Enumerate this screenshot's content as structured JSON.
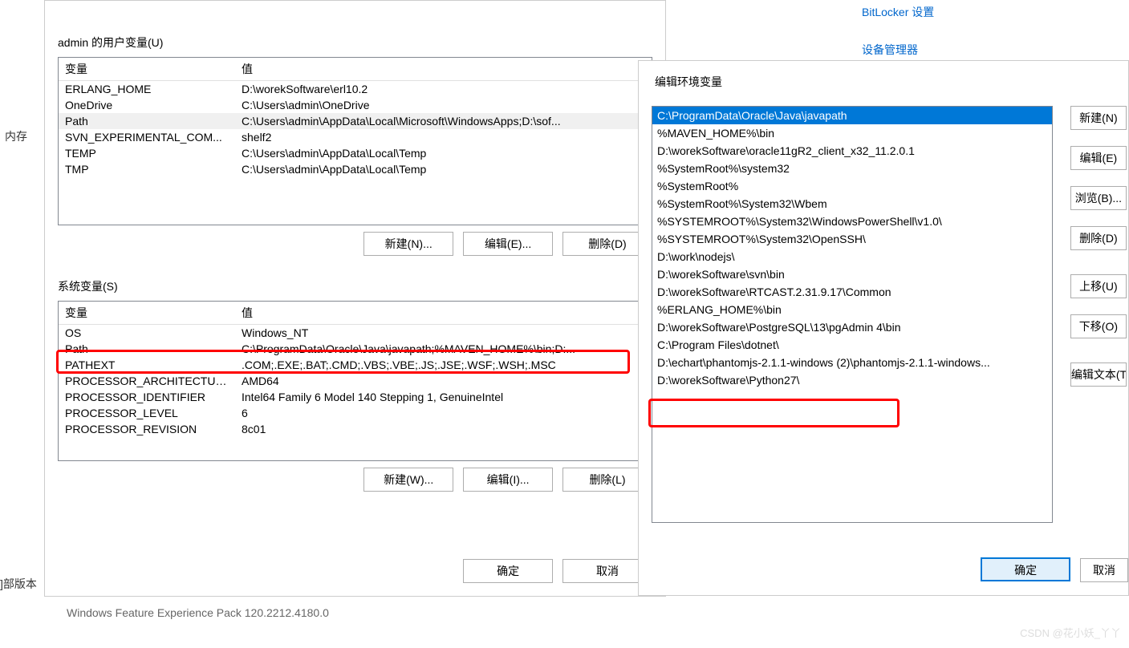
{
  "bg": {
    "link1": "BitLocker 设置",
    "link2": "设备管理器",
    "mem": "内存",
    "ver": "]部版本",
    "pack": "Windows Feature Experience Pack 120.2212.4180.0",
    "watermark": "CSDN @花小妖_丫丫"
  },
  "envvars": {
    "user_label": "admin 的用户变量(U)",
    "sys_label": "系统变量(S)",
    "col_var": "变量",
    "col_val": "值",
    "user_rows": [
      {
        "k": "ERLANG_HOME",
        "v": "D:\\worekSoftware\\erl10.2"
      },
      {
        "k": "OneDrive",
        "v": "C:\\Users\\admin\\OneDrive"
      },
      {
        "k": "Path",
        "v": "C:\\Users\\admin\\AppData\\Local\\Microsoft\\WindowsApps;D:\\sof...",
        "sel": true
      },
      {
        "k": "SVN_EXPERIMENTAL_COM...",
        "v": "shelf2"
      },
      {
        "k": "TEMP",
        "v": "C:\\Users\\admin\\AppData\\Local\\Temp"
      },
      {
        "k": "TMP",
        "v": "C:\\Users\\admin\\AppData\\Local\\Temp"
      }
    ],
    "sys_rows": [
      {
        "k": "OS",
        "v": "Windows_NT"
      },
      {
        "k": "Path",
        "v": "C:\\ProgramData\\Oracle\\Java\\javapath;%MAVEN_HOME%\\bin;D:..."
      },
      {
        "k": "PATHEXT",
        "v": ".COM;.EXE;.BAT;.CMD;.VBS;.VBE;.JS;.JSE;.WSF;.WSH;.MSC"
      },
      {
        "k": "PROCESSOR_ARCHITECTURE",
        "v": "AMD64"
      },
      {
        "k": "PROCESSOR_IDENTIFIER",
        "v": "Intel64 Family 6 Model 140 Stepping 1, GenuineIntel"
      },
      {
        "k": "PROCESSOR_LEVEL",
        "v": "6"
      },
      {
        "k": "PROCESSOR_REVISION",
        "v": "8c01"
      }
    ],
    "btn_new_u": "新建(N)...",
    "btn_edit_u": "编辑(E)...",
    "btn_del_u": "删除(D)",
    "btn_new_s": "新建(W)...",
    "btn_edit_s": "编辑(I)...",
    "btn_del_s": "删除(L)",
    "ok": "确定",
    "cancel": "取消"
  },
  "editvar": {
    "title": "编辑环境变量",
    "items": [
      {
        "v": "C:\\ProgramData\\Oracle\\Java\\javapath",
        "sel": true
      },
      {
        "v": "%MAVEN_HOME%\\bin"
      },
      {
        "v": "D:\\worekSoftware\\oracle11gR2_client_x32_11.2.0.1"
      },
      {
        "v": "%SystemRoot%\\system32"
      },
      {
        "v": "%SystemRoot%"
      },
      {
        "v": "%SystemRoot%\\System32\\Wbem"
      },
      {
        "v": "%SYSTEMROOT%\\System32\\WindowsPowerShell\\v1.0\\"
      },
      {
        "v": "%SYSTEMROOT%\\System32\\OpenSSH\\"
      },
      {
        "v": "D:\\work\\nodejs\\"
      },
      {
        "v": "D:\\worekSoftware\\svn\\bin"
      },
      {
        "v": "D:\\worekSoftware\\RTCAST.2.31.9.17\\Common"
      },
      {
        "v": "%ERLANG_HOME%\\bin"
      },
      {
        "v": "D:\\worekSoftware\\PostgreSQL\\13\\pgAdmin 4\\bin"
      },
      {
        "v": "C:\\Program Files\\dotnet\\"
      },
      {
        "v": "D:\\echart\\phantomjs-2.1.1-windows (2)\\phantomjs-2.1.1-windows..."
      },
      {
        "v": "D:\\worekSoftware\\Python27\\"
      }
    ],
    "btn_new": "新建(N)",
    "btn_edit": "编辑(E)",
    "btn_browse": "浏览(B)...",
    "btn_del": "删除(D)",
    "btn_up": "上移(U)",
    "btn_down": "下移(O)",
    "btn_edittext": "编辑文本(T)...",
    "ok": "确定",
    "cancel": "取消"
  }
}
